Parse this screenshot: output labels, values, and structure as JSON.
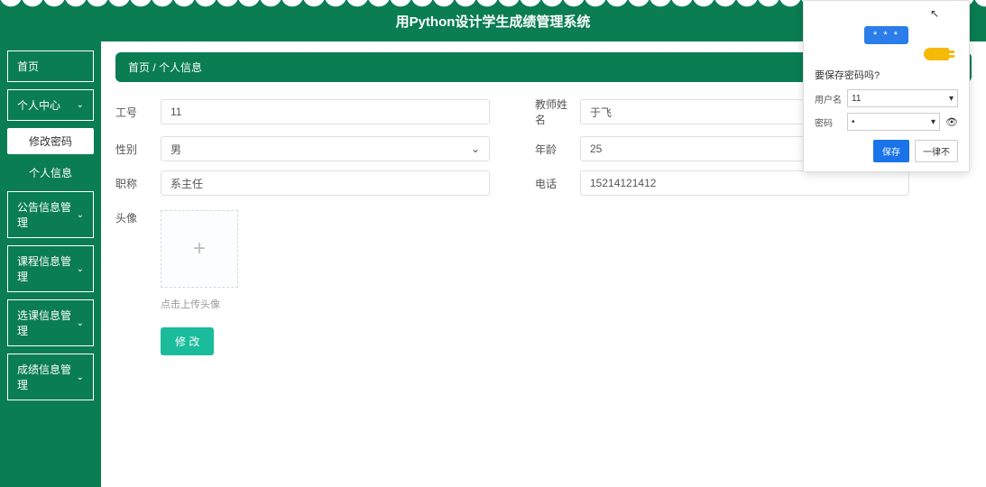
{
  "header": {
    "title": "用Python设计学生成绩管理系统"
  },
  "sidebar": {
    "items": [
      {
        "label": "首页",
        "expandable": false
      },
      {
        "label": "个人中心",
        "expandable": true,
        "sub": [
          {
            "label": "修改密码",
            "active": true
          },
          {
            "label": "个人信息",
            "active": false
          }
        ]
      },
      {
        "label": "公告信息管理",
        "expandable": true
      },
      {
        "label": "课程信息管理",
        "expandable": true
      },
      {
        "label": "选课信息管理",
        "expandable": true
      },
      {
        "label": "成绩信息管理",
        "expandable": true
      }
    ]
  },
  "breadcrumb": {
    "home": "首页",
    "sep": " / ",
    "current": "个人信息"
  },
  "form": {
    "fields": {
      "worker_id": {
        "label": "工号",
        "value": "11"
      },
      "teacher_name": {
        "label": "教师姓名",
        "value": "于飞"
      },
      "gender": {
        "label": "性别",
        "value": "男"
      },
      "age": {
        "label": "年龄",
        "value": "25"
      },
      "title": {
        "label": "职称",
        "value": "系主任"
      },
      "phone": {
        "label": "电话",
        "value": "15214121412"
      },
      "avatar": {
        "label": "头像",
        "hint": "点击上传头像"
      }
    },
    "submit_label": "修 改"
  },
  "password_dialog": {
    "badge": "* * *",
    "prompt": "要保存密码吗?",
    "username_label": "用户名",
    "username_value": "11",
    "password_label": "密码",
    "password_value": "•",
    "save_label": "保存",
    "never_label": "一律不"
  }
}
